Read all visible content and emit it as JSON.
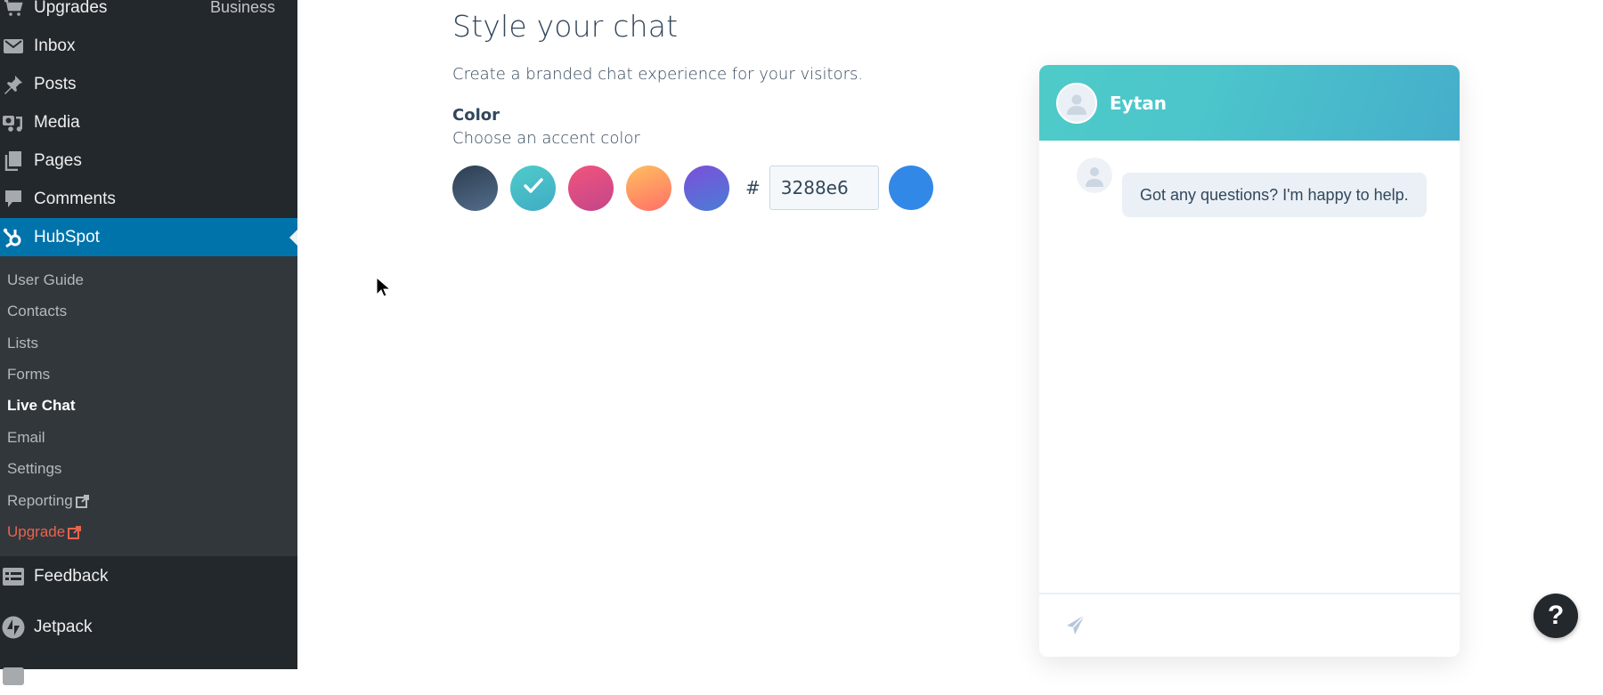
{
  "sidebar": {
    "top_items": [
      {
        "label": "Upgrades",
        "icon": "cart-icon",
        "badge": "Business"
      },
      {
        "label": "Inbox",
        "icon": "mail-icon"
      },
      {
        "label": "Posts",
        "icon": "pin-icon"
      },
      {
        "label": "Media",
        "icon": "media-icon"
      },
      {
        "label": "Pages",
        "icon": "pages-icon"
      },
      {
        "label": "Comments",
        "icon": "comment-icon"
      },
      {
        "label": "HubSpot",
        "icon": "hubspot-icon",
        "active": true
      }
    ],
    "submenu": [
      {
        "label": "User Guide"
      },
      {
        "label": "Contacts"
      },
      {
        "label": "Lists"
      },
      {
        "label": "Forms"
      },
      {
        "label": "Live Chat",
        "current": true
      },
      {
        "label": "Email"
      },
      {
        "label": "Settings"
      },
      {
        "label": "Reporting",
        "external": true
      },
      {
        "label": "Upgrade",
        "external": true,
        "highlight": true
      }
    ],
    "bottom_items": [
      {
        "label": "Feedback",
        "icon": "feedback-icon"
      },
      {
        "label": "Jetpack",
        "icon": "jetpack-icon"
      }
    ]
  },
  "main": {
    "title": "Style your chat",
    "subtitle": "Create a branded chat experience for your visitors.",
    "color_label": "Color",
    "color_sublabel": "Choose an accent color",
    "swatches": [
      {
        "name": "dark-slate",
        "from": "#2d3e50",
        "to": "#536d8c",
        "selected": false
      },
      {
        "name": "teal",
        "from": "#4fcbc9",
        "to": "#40acc4",
        "selected": true
      },
      {
        "name": "pink",
        "from": "#f2547d",
        "to": "#c2468a",
        "selected": false
      },
      {
        "name": "orange",
        "from": "#ffbf60",
        "to": "#ff6f67",
        "selected": false
      },
      {
        "name": "purple",
        "from": "#7c4fd9",
        "to": "#4a7dd6",
        "selected": false
      }
    ],
    "hash_symbol": "#",
    "hex_value": "3288e6",
    "custom_color": "#3288e6"
  },
  "chat_preview": {
    "agent_name": "Eytan",
    "message": "Got any questions? I'm happy to help.",
    "header_color": "#4cc5cb"
  },
  "help_button": {
    "label": "?"
  }
}
